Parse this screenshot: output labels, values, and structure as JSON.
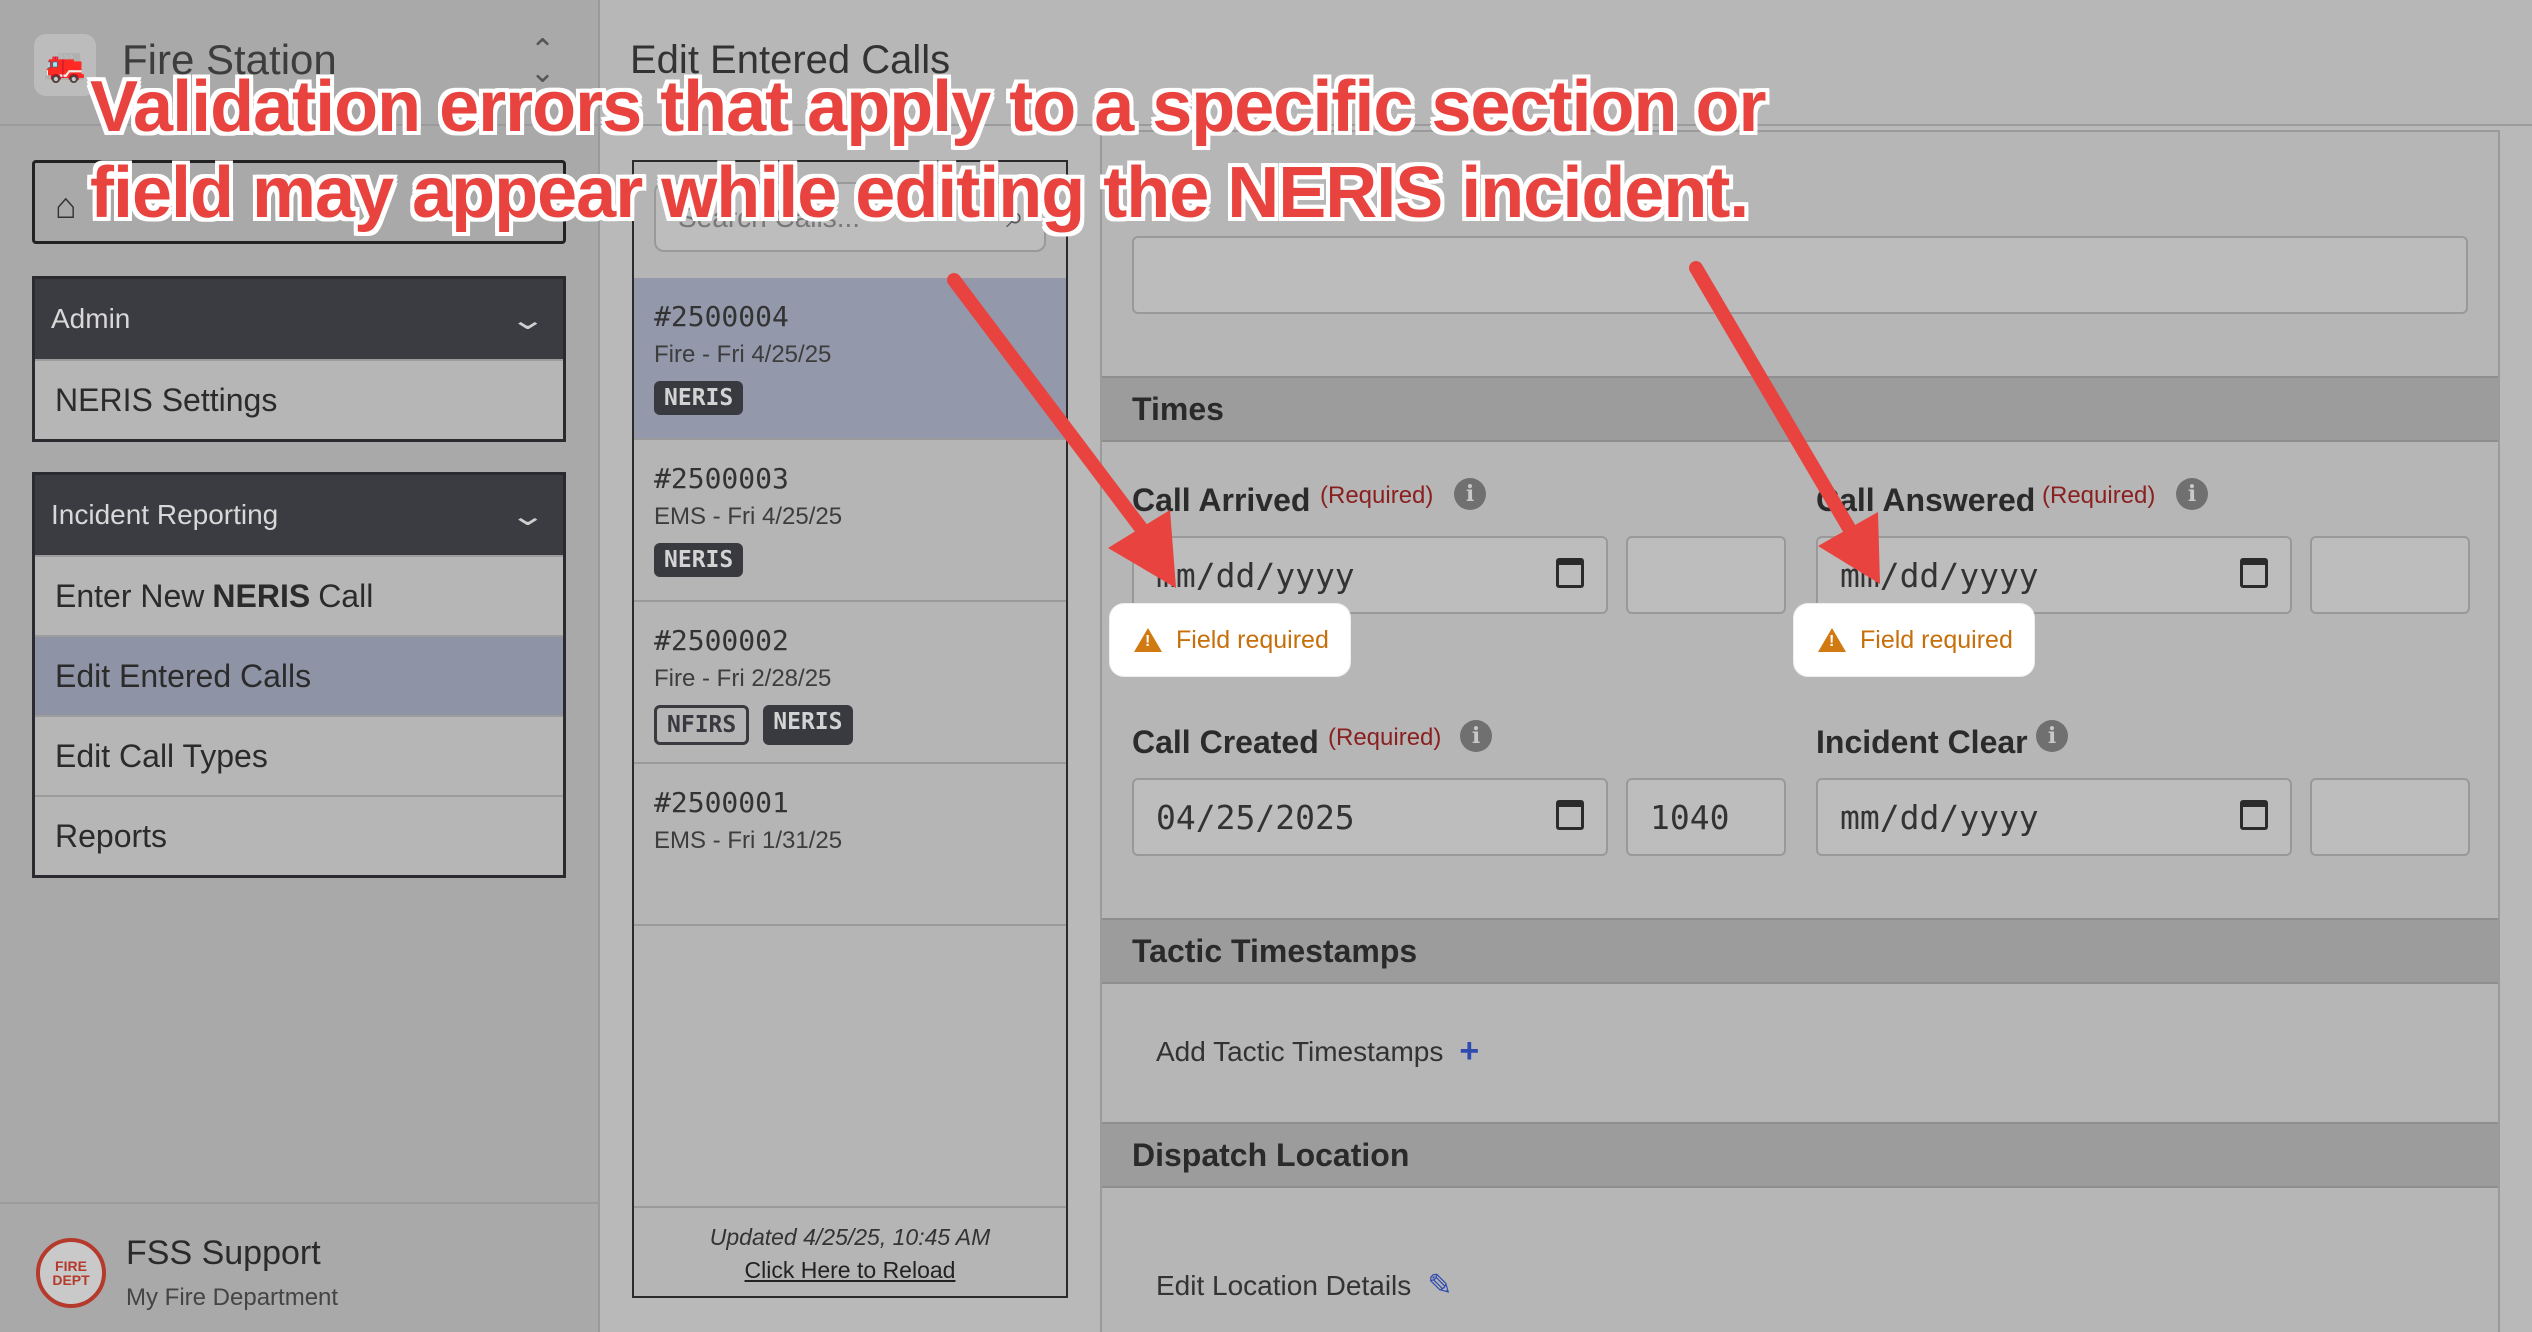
{
  "sidebar": {
    "station_name": "Fire Station",
    "sections": [
      {
        "title": "Admin",
        "items": [
          {
            "label": "NERIS Settings"
          }
        ]
      },
      {
        "title": "Incident Reporting",
        "items": [
          {
            "label": "Enter New",
            "bold": "NERIS",
            "suffix": "Call"
          },
          {
            "label": "Edit Entered Calls"
          },
          {
            "label": "Edit Call Types"
          },
          {
            "label": "Reports"
          }
        ]
      }
    ],
    "user": {
      "name": "FSS Support",
      "department": "My Fire Department",
      "badge_text": "FIRE DEPT"
    }
  },
  "header": {
    "title": "Edit Entered Calls"
  },
  "calls": {
    "search_placeholder": "Search Calls...",
    "items": [
      {
        "number": "#2500004",
        "sub": "Fire - Fri 4/25/25",
        "tags": [
          "NERIS"
        ]
      },
      {
        "number": "#2500003",
        "sub": "EMS - Fri 4/25/25",
        "tags": [
          "NERIS"
        ]
      },
      {
        "number": "#2500002",
        "sub": "Fire - Fri 2/28/25",
        "tags": [
          "NFIRS",
          "NERIS"
        ]
      },
      {
        "number": "#2500001",
        "sub": "EMS - Fri 1/31/25",
        "tags": []
      }
    ],
    "updated": "Updated 4/25/25, 10:45 AM",
    "reload": "Click Here to Reload"
  },
  "form": {
    "times_title": "Times",
    "required_text": "(Required)",
    "error_text": "Field required",
    "call_arrived": {
      "label": "Call Arrived",
      "date": "mm/dd/yyyy",
      "time": ""
    },
    "call_answered": {
      "label": "Call Answered",
      "date": "mm/dd/yyyy",
      "time": ""
    },
    "call_created": {
      "label": "Call Created",
      "date": "04/25/2025",
      "time": "1040"
    },
    "incident_clear": {
      "label": "Incident Clear",
      "date": "mm/dd/yyyy",
      "time": ""
    },
    "tactic_title": "Tactic Timestamps",
    "tactic_link": "Add Tactic Timestamps",
    "dispatch_title": "Dispatch Location",
    "dispatch_link": "Edit Location Details"
  },
  "annotation": {
    "line1": "Validation errors that apply to a specific section or",
    "line2": "field may appear while editing the NERIS incident."
  },
  "colors": {
    "annotation": "#e8433f",
    "error": "#c7700b",
    "required": "#8a1f1f",
    "link_icon": "#2f4bb0"
  }
}
